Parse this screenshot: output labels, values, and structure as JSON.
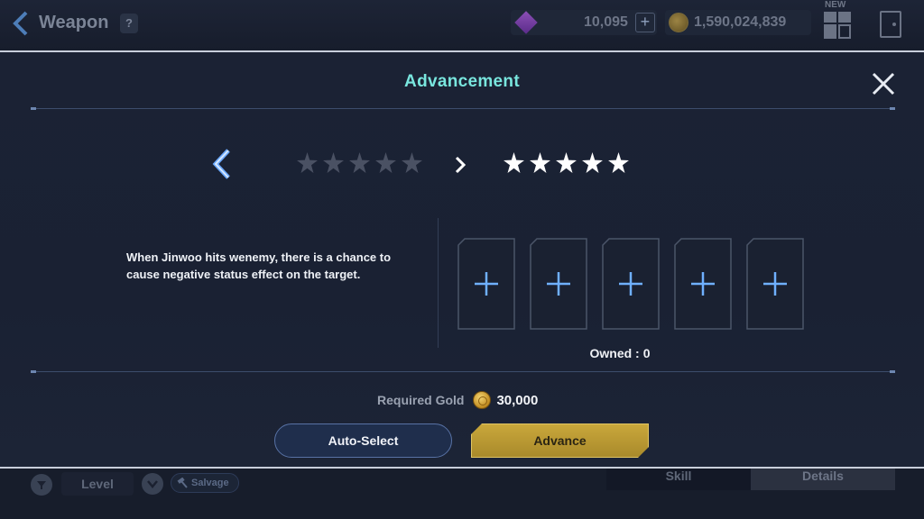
{
  "hud": {
    "title": "Weapon",
    "help": "?",
    "gem_amount": "10,095",
    "gold_amount": "1,590,024,839",
    "new_badge": "NEW",
    "plus": "+",
    "level_filter": "Level",
    "salvage_label": "Salvage",
    "tabs": {
      "skill": "Skill",
      "details": "Details"
    }
  },
  "modal": {
    "title": "Advancement",
    "current_stars": {
      "filled": 0,
      "total": 5
    },
    "next_stars": {
      "filled": 5,
      "total": 5
    },
    "description": "When Jinwoo hits wenemy, there is a chance to cause negative status effect on the target.",
    "material_slots": 5,
    "owned_label": "Owned :",
    "owned_value": "0",
    "required_gold_label": "Required Gold",
    "required_gold_value": "30,000",
    "auto_select_label": "Auto-Select",
    "advance_label": "Advance"
  },
  "colors": {
    "title_accent": "#79e6de",
    "advance_button": "#c9a73b",
    "slot_plus": "#6fb0ff"
  }
}
